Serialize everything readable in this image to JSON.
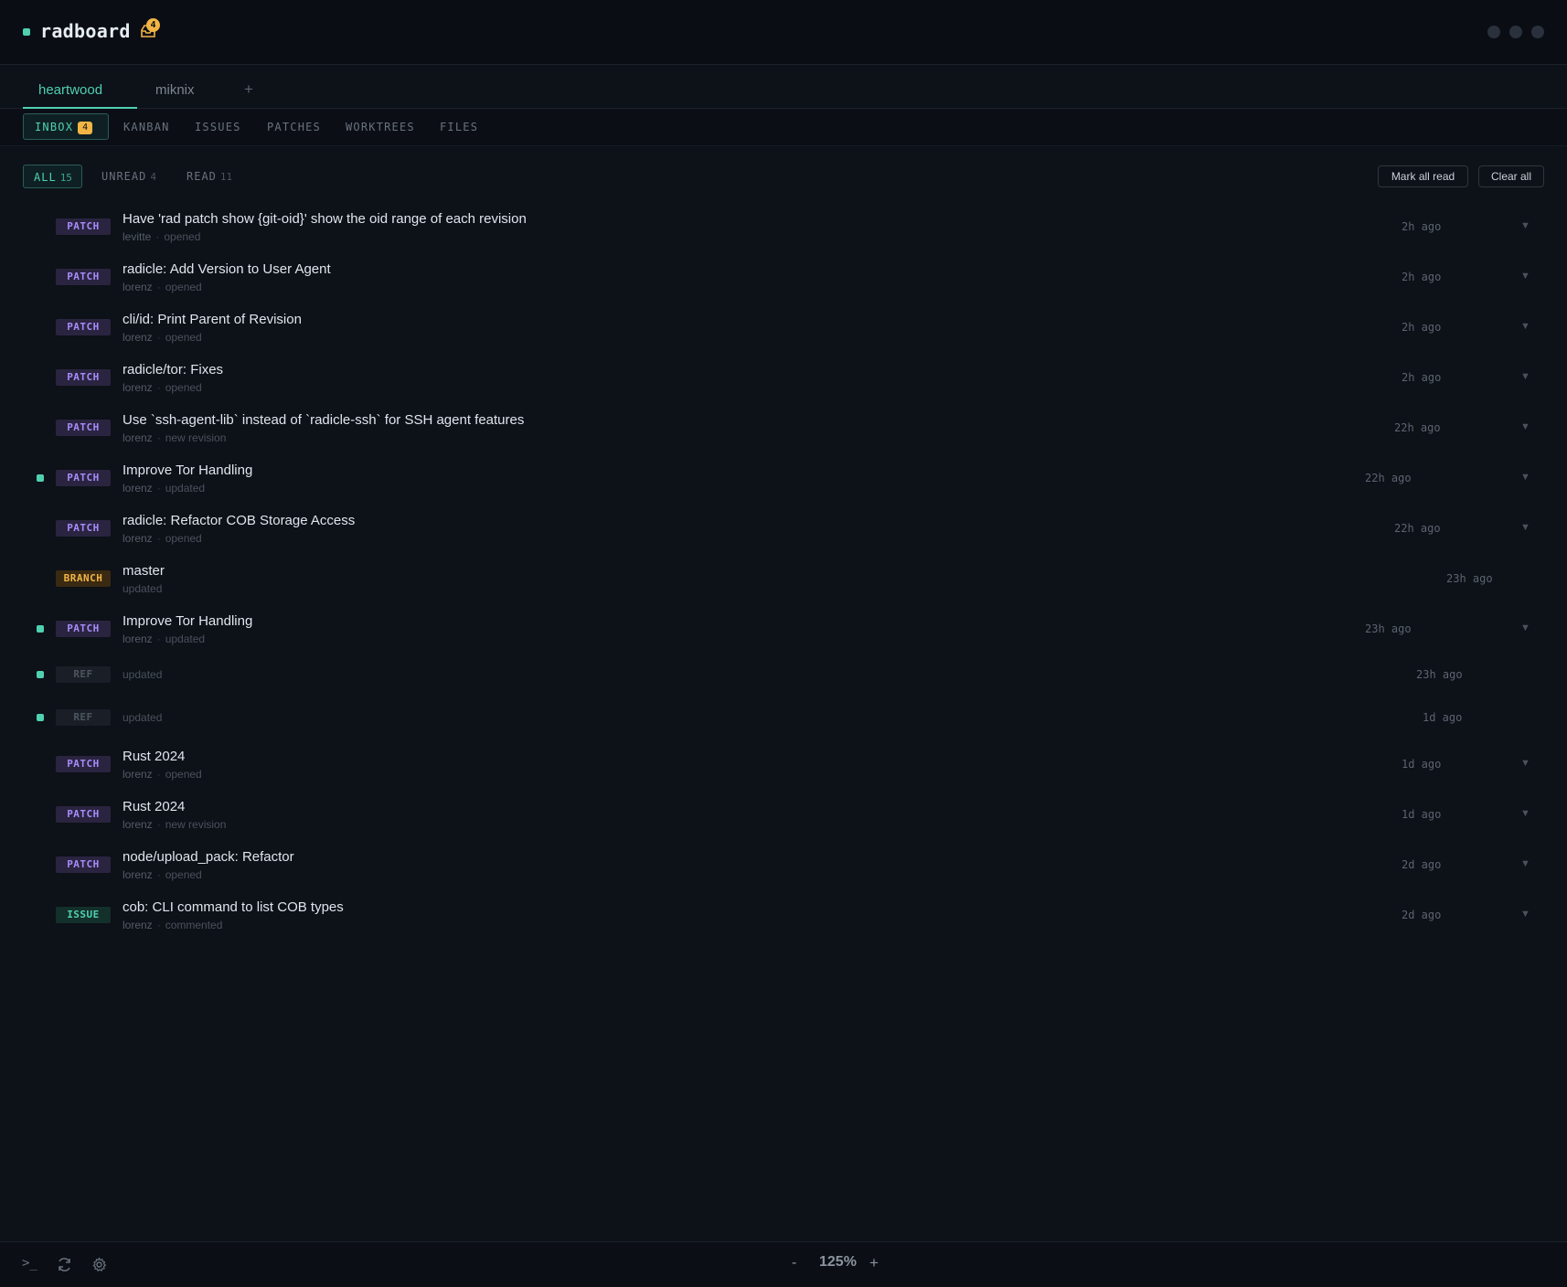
{
  "app": {
    "name": "radboard",
    "inbox_count": "4"
  },
  "repo_tabs": [
    {
      "label": "heartwood"
    },
    {
      "label": "miknix"
    }
  ],
  "repo_add": "+",
  "section_tabs": {
    "inbox": "INBOX",
    "inbox_badge": "4",
    "kanban": "KANBAN",
    "issues": "ISSUES",
    "patches": "PATCHES",
    "worktrees": "WORKTREES",
    "files": "FILES"
  },
  "filters": {
    "all": "ALL",
    "all_count": "15",
    "unread": "UNREAD",
    "unread_count": "4",
    "read": "READ",
    "read_count": "11"
  },
  "actions": {
    "mark_all_read": "Mark all read",
    "clear_all": "Clear all"
  },
  "notifications": [
    {
      "tag": "PATCH",
      "title": "Have 'rad patch show {git-oid}' show the oid range of each revision",
      "author": "levitte",
      "action": "opened",
      "time": "2h ago",
      "unread": false
    },
    {
      "tag": "PATCH",
      "title": "radicle: Add Version to User Agent",
      "author": "lorenz",
      "action": "opened",
      "time": "2h ago",
      "unread": false
    },
    {
      "tag": "PATCH",
      "title": "cli/id: Print Parent of Revision",
      "author": "lorenz",
      "action": "opened",
      "time": "2h ago",
      "unread": false
    },
    {
      "tag": "PATCH",
      "title": "radicle/tor: Fixes",
      "author": "lorenz",
      "action": "opened",
      "time": "2h ago",
      "unread": false
    },
    {
      "tag": "PATCH",
      "title": "Use `ssh-agent-lib` instead of `radicle-ssh` for SSH agent features",
      "author": "lorenz",
      "action": "new revision",
      "time": "22h ago",
      "unread": false
    },
    {
      "tag": "PATCH",
      "title": "Improve Tor Handling",
      "author": "lorenz",
      "action": "updated",
      "time": "22h ago",
      "unread": true
    },
    {
      "tag": "PATCH",
      "title": "radicle: Refactor COB Storage Access",
      "author": "lorenz",
      "action": "opened",
      "time": "22h ago",
      "unread": false
    },
    {
      "tag": "BRANCH",
      "title": "master",
      "author": "",
      "action": "updated",
      "time": "23h ago",
      "unread": false
    },
    {
      "tag": "PATCH",
      "title": "Improve Tor Handling",
      "author": "lorenz",
      "action": "updated",
      "time": "23h ago",
      "unread": true
    },
    {
      "tag": "REF",
      "title": "",
      "author": "",
      "action": "updated",
      "time": "23h ago",
      "unread": true
    },
    {
      "tag": "REF",
      "title": "",
      "author": "",
      "action": "updated",
      "time": "1d ago",
      "unread": true
    },
    {
      "tag": "PATCH",
      "title": "Rust 2024",
      "author": "lorenz",
      "action": "opened",
      "time": "1d ago",
      "unread": false
    },
    {
      "tag": "PATCH",
      "title": "Rust 2024",
      "author": "lorenz",
      "action": "new revision",
      "time": "1d ago",
      "unread": false
    },
    {
      "tag": "PATCH",
      "title": "node/upload_pack: Refactor",
      "author": "lorenz",
      "action": "opened",
      "time": "2d ago",
      "unread": false
    },
    {
      "tag": "ISSUE",
      "title": "cob: CLI command to list COB types",
      "author": "lorenz",
      "action": "commented",
      "time": "2d ago",
      "unread": false
    }
  ],
  "footer": {
    "terminal": ">_",
    "zoom_minus": "-",
    "zoom": "125%",
    "zoom_plus": "+"
  },
  "colors": {
    "accent": "#4fd1b0",
    "badge": "#f2b544",
    "patch": "#a78bfa",
    "background": "#0d1118"
  }
}
